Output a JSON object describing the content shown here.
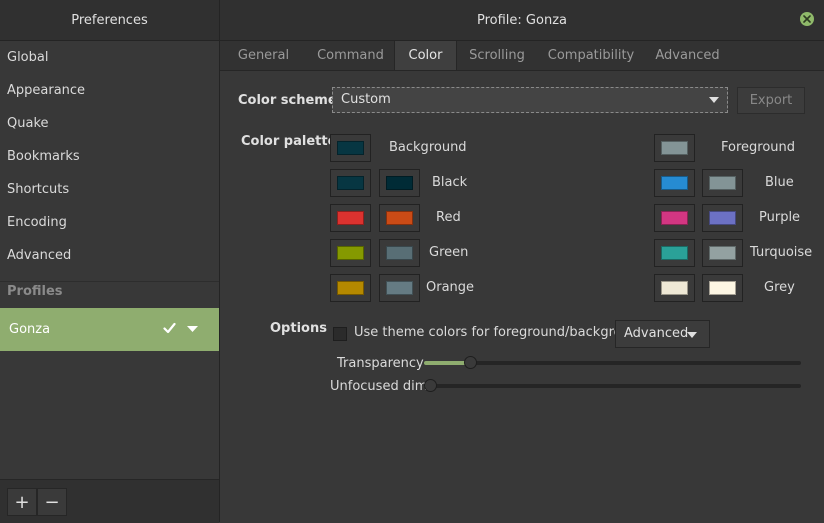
{
  "left_title": "Preferences",
  "window_title": "Profile: Gonza",
  "sidebar": {
    "items": [
      {
        "label": "Global"
      },
      {
        "label": "Appearance"
      },
      {
        "label": "Quake"
      },
      {
        "label": "Bookmarks"
      },
      {
        "label": "Shortcuts"
      },
      {
        "label": "Encoding"
      },
      {
        "label": "Advanced"
      }
    ],
    "profiles_header": "Profiles",
    "profile_name": "Gonza",
    "add_label": "+",
    "remove_label": "−"
  },
  "tabs": [
    {
      "label": "General"
    },
    {
      "label": "Command"
    },
    {
      "label": "Color",
      "active": true
    },
    {
      "label": "Scrolling"
    },
    {
      "label": "Compatibility"
    },
    {
      "label": "Advanced"
    }
  ],
  "color": {
    "scheme_label": "Color scheme",
    "scheme_value": "Custom",
    "export_label": "Export",
    "palette_label": "Color palette",
    "palette": {
      "background": {
        "label": "Background",
        "color": "#073642"
      },
      "black": {
        "label": "Black",
        "colors": [
          "#073642",
          "#002b36"
        ]
      },
      "red": {
        "label": "Red",
        "colors": [
          "#dc322f",
          "#cb4b16"
        ]
      },
      "green": {
        "label": "Green",
        "colors": [
          "#859900",
          "#586e75"
        ]
      },
      "orange": {
        "label": "Orange",
        "colors": [
          "#b58900",
          "#657b83"
        ]
      },
      "foreground": {
        "label": "Foreground",
        "color": "#839496"
      },
      "blue": {
        "label": "Blue",
        "colors": [
          "#268bd2",
          "#839496"
        ]
      },
      "purple": {
        "label": "Purple",
        "colors": [
          "#d33682",
          "#6c71c4"
        ]
      },
      "turquoise": {
        "label": "Turquoise",
        "colors": [
          "#2aa198",
          "#93a1a1"
        ]
      },
      "grey": {
        "label": "Grey",
        "colors": [
          "#eee8d5",
          "#fdf6e3"
        ]
      }
    },
    "options_label": "Options",
    "theme_colors_label": "Use theme colors for foreground/background",
    "theme_colors_checked": false,
    "advanced_button": "Advanced",
    "transparency_label": "Transparency",
    "transparency_value": 0.11,
    "unfocused_dim_label": "Unfocused dim",
    "unfocused_dim_value": 0.0
  },
  "colors": {
    "accent": "#8fad6f",
    "close_button": "#8fb96a"
  },
  "icons": {
    "close": "close-icon",
    "check": "checkmark-icon",
    "dropdown": "chevron-down-icon"
  }
}
